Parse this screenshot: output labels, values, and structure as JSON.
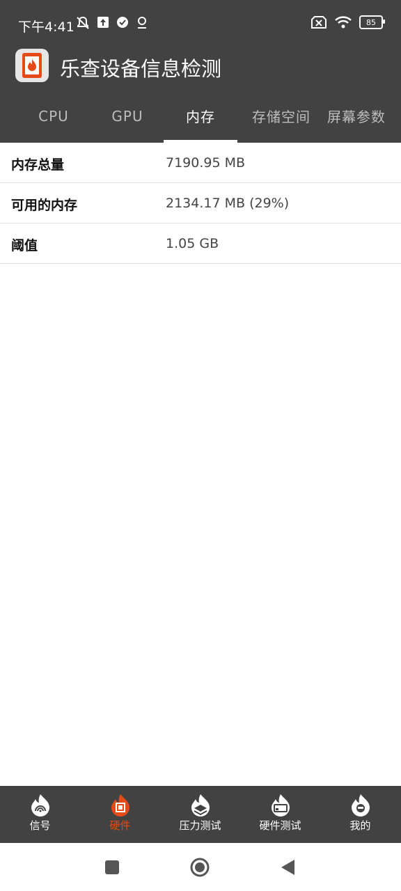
{
  "status": {
    "time": "下午4:41",
    "battery": "85"
  },
  "app": {
    "title": "乐查设备信息检测"
  },
  "tabs": [
    {
      "label": "CPU"
    },
    {
      "label": "GPU"
    },
    {
      "label": "内存"
    },
    {
      "label": "存储空间"
    },
    {
      "label": "屏幕参数"
    }
  ],
  "active_tab": "内存",
  "memory_info": [
    {
      "label": "内存总量",
      "value": "7190.95 MB"
    },
    {
      "label": "可用的内存",
      "value": "2134.17 MB (29%)"
    },
    {
      "label": "阈值",
      "value": "1.05 GB"
    }
  ],
  "bottom_nav": [
    {
      "label": "信号",
      "icon": "signal-flame-icon"
    },
    {
      "label": "硬件",
      "icon": "chip-flame-icon"
    },
    {
      "label": "压力测试",
      "icon": "layers-flame-icon"
    },
    {
      "label": "硬件测试",
      "icon": "device-flame-icon"
    },
    {
      "label": "我的",
      "icon": "profile-flame-icon"
    }
  ],
  "active_nav": "硬件",
  "colors": {
    "bar": "#424242",
    "accent": "#e64a19"
  }
}
